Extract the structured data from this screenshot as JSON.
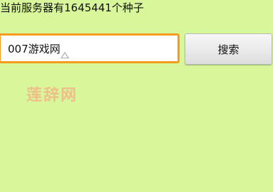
{
  "status": {
    "text": "当前服务器有1645441个种子"
  },
  "search": {
    "value": "007游戏网",
    "button_label": "搜索"
  },
  "watermark": {
    "text": "莲辞网"
  },
  "colors": {
    "background": "#d8f79a",
    "input_focus_border": "#f39c1e",
    "watermark": "#f2b98a"
  }
}
